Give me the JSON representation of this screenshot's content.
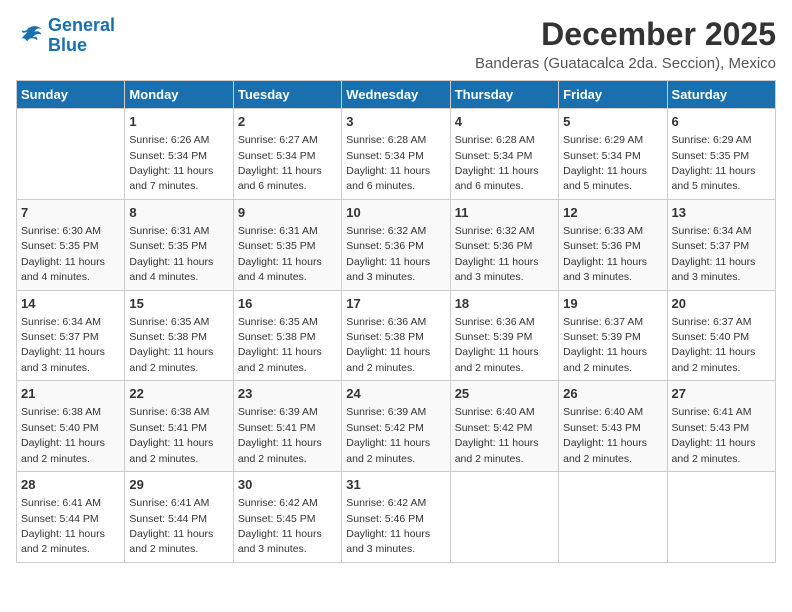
{
  "logo": {
    "line1": "General",
    "line2": "Blue"
  },
  "title": "December 2025",
  "location": "Banderas (Guatacalca 2da. Seccion), Mexico",
  "days_of_week": [
    "Sunday",
    "Monday",
    "Tuesday",
    "Wednesday",
    "Thursday",
    "Friday",
    "Saturday"
  ],
  "weeks": [
    [
      {
        "day": "",
        "sunrise": "",
        "sunset": "",
        "daylight": ""
      },
      {
        "day": "1",
        "sunrise": "Sunrise: 6:26 AM",
        "sunset": "Sunset: 5:34 PM",
        "daylight": "Daylight: 11 hours and 7 minutes."
      },
      {
        "day": "2",
        "sunrise": "Sunrise: 6:27 AM",
        "sunset": "Sunset: 5:34 PM",
        "daylight": "Daylight: 11 hours and 6 minutes."
      },
      {
        "day": "3",
        "sunrise": "Sunrise: 6:28 AM",
        "sunset": "Sunset: 5:34 PM",
        "daylight": "Daylight: 11 hours and 6 minutes."
      },
      {
        "day": "4",
        "sunrise": "Sunrise: 6:28 AM",
        "sunset": "Sunset: 5:34 PM",
        "daylight": "Daylight: 11 hours and 6 minutes."
      },
      {
        "day": "5",
        "sunrise": "Sunrise: 6:29 AM",
        "sunset": "Sunset: 5:34 PM",
        "daylight": "Daylight: 11 hours and 5 minutes."
      },
      {
        "day": "6",
        "sunrise": "Sunrise: 6:29 AM",
        "sunset": "Sunset: 5:35 PM",
        "daylight": "Daylight: 11 hours and 5 minutes."
      }
    ],
    [
      {
        "day": "7",
        "sunrise": "Sunrise: 6:30 AM",
        "sunset": "Sunset: 5:35 PM",
        "daylight": "Daylight: 11 hours and 4 minutes."
      },
      {
        "day": "8",
        "sunrise": "Sunrise: 6:31 AM",
        "sunset": "Sunset: 5:35 PM",
        "daylight": "Daylight: 11 hours and 4 minutes."
      },
      {
        "day": "9",
        "sunrise": "Sunrise: 6:31 AM",
        "sunset": "Sunset: 5:35 PM",
        "daylight": "Daylight: 11 hours and 4 minutes."
      },
      {
        "day": "10",
        "sunrise": "Sunrise: 6:32 AM",
        "sunset": "Sunset: 5:36 PM",
        "daylight": "Daylight: 11 hours and 3 minutes."
      },
      {
        "day": "11",
        "sunrise": "Sunrise: 6:32 AM",
        "sunset": "Sunset: 5:36 PM",
        "daylight": "Daylight: 11 hours and 3 minutes."
      },
      {
        "day": "12",
        "sunrise": "Sunrise: 6:33 AM",
        "sunset": "Sunset: 5:36 PM",
        "daylight": "Daylight: 11 hours and 3 minutes."
      },
      {
        "day": "13",
        "sunrise": "Sunrise: 6:34 AM",
        "sunset": "Sunset: 5:37 PM",
        "daylight": "Daylight: 11 hours and 3 minutes."
      }
    ],
    [
      {
        "day": "14",
        "sunrise": "Sunrise: 6:34 AM",
        "sunset": "Sunset: 5:37 PM",
        "daylight": "Daylight: 11 hours and 3 minutes."
      },
      {
        "day": "15",
        "sunrise": "Sunrise: 6:35 AM",
        "sunset": "Sunset: 5:38 PM",
        "daylight": "Daylight: 11 hours and 2 minutes."
      },
      {
        "day": "16",
        "sunrise": "Sunrise: 6:35 AM",
        "sunset": "Sunset: 5:38 PM",
        "daylight": "Daylight: 11 hours and 2 minutes."
      },
      {
        "day": "17",
        "sunrise": "Sunrise: 6:36 AM",
        "sunset": "Sunset: 5:38 PM",
        "daylight": "Daylight: 11 hours and 2 minutes."
      },
      {
        "day": "18",
        "sunrise": "Sunrise: 6:36 AM",
        "sunset": "Sunset: 5:39 PM",
        "daylight": "Daylight: 11 hours and 2 minutes."
      },
      {
        "day": "19",
        "sunrise": "Sunrise: 6:37 AM",
        "sunset": "Sunset: 5:39 PM",
        "daylight": "Daylight: 11 hours and 2 minutes."
      },
      {
        "day": "20",
        "sunrise": "Sunrise: 6:37 AM",
        "sunset": "Sunset: 5:40 PM",
        "daylight": "Daylight: 11 hours and 2 minutes."
      }
    ],
    [
      {
        "day": "21",
        "sunrise": "Sunrise: 6:38 AM",
        "sunset": "Sunset: 5:40 PM",
        "daylight": "Daylight: 11 hours and 2 minutes."
      },
      {
        "day": "22",
        "sunrise": "Sunrise: 6:38 AM",
        "sunset": "Sunset: 5:41 PM",
        "daylight": "Daylight: 11 hours and 2 minutes."
      },
      {
        "day": "23",
        "sunrise": "Sunrise: 6:39 AM",
        "sunset": "Sunset: 5:41 PM",
        "daylight": "Daylight: 11 hours and 2 minutes."
      },
      {
        "day": "24",
        "sunrise": "Sunrise: 6:39 AM",
        "sunset": "Sunset: 5:42 PM",
        "daylight": "Daylight: 11 hours and 2 minutes."
      },
      {
        "day": "25",
        "sunrise": "Sunrise: 6:40 AM",
        "sunset": "Sunset: 5:42 PM",
        "daylight": "Daylight: 11 hours and 2 minutes."
      },
      {
        "day": "26",
        "sunrise": "Sunrise: 6:40 AM",
        "sunset": "Sunset: 5:43 PM",
        "daylight": "Daylight: 11 hours and 2 minutes."
      },
      {
        "day": "27",
        "sunrise": "Sunrise: 6:41 AM",
        "sunset": "Sunset: 5:43 PM",
        "daylight": "Daylight: 11 hours and 2 minutes."
      }
    ],
    [
      {
        "day": "28",
        "sunrise": "Sunrise: 6:41 AM",
        "sunset": "Sunset: 5:44 PM",
        "daylight": "Daylight: 11 hours and 2 minutes."
      },
      {
        "day": "29",
        "sunrise": "Sunrise: 6:41 AM",
        "sunset": "Sunset: 5:44 PM",
        "daylight": "Daylight: 11 hours and 2 minutes."
      },
      {
        "day": "30",
        "sunrise": "Sunrise: 6:42 AM",
        "sunset": "Sunset: 5:45 PM",
        "daylight": "Daylight: 11 hours and 3 minutes."
      },
      {
        "day": "31",
        "sunrise": "Sunrise: 6:42 AM",
        "sunset": "Sunset: 5:46 PM",
        "daylight": "Daylight: 11 hours and 3 minutes."
      },
      {
        "day": "",
        "sunrise": "",
        "sunset": "",
        "daylight": ""
      },
      {
        "day": "",
        "sunrise": "",
        "sunset": "",
        "daylight": ""
      },
      {
        "day": "",
        "sunrise": "",
        "sunset": "",
        "daylight": ""
      }
    ]
  ]
}
